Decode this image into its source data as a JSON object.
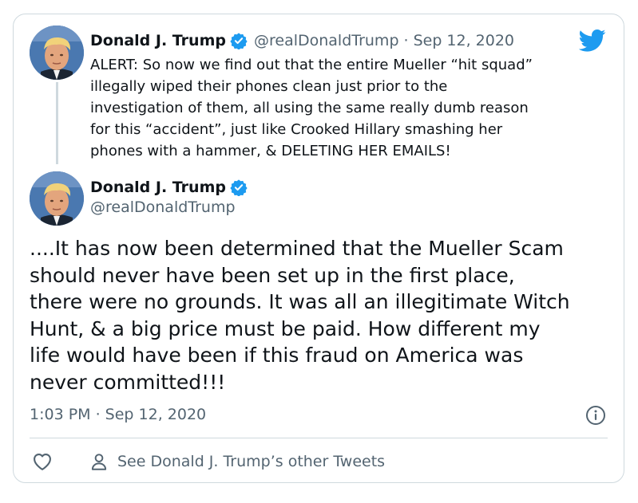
{
  "tweet1": {
    "name": "Donald J. Trump",
    "handle": "@realDonaldTrump",
    "separator": "·",
    "date": "Sep 12, 2020",
    "text": "ALERT: So now we find out that the entire Mueller “hit squad”\nillegally wiped their phones clean just prior to the\ninvestigation of them, all using the same really dumb reason\nfor this “accident”, just like Crooked Hillary smashing her\nphones with a hammer, & DELETING HER EMAILS!"
  },
  "tweet2": {
    "name": "Donald J. Trump",
    "handle": "@realDonaldTrump",
    "text": "....It has now been determined that the Mueller Scam\nshould never have been set up in the first place,\nthere were no grounds. It was all an illegitimate Witch\nHunt, & a big price must be paid. How different my\nlife would have been if this fraud on America was\nnever committed!!!",
    "timestamp": "1:03 PM · Sep 12, 2020"
  },
  "footer": {
    "other_tweets_label": "See Donald J. Trump’s other Tweets"
  },
  "icons": {
    "brand": "twitter-bird-icon",
    "verified": "verified-badge-icon",
    "info": "info-icon",
    "like": "heart-icon",
    "profile": "person-icon"
  },
  "colors": {
    "twitter_blue": "#1d9bf0",
    "text": "#0f1419",
    "secondary_text": "#536471",
    "border": "#cfd9de"
  }
}
